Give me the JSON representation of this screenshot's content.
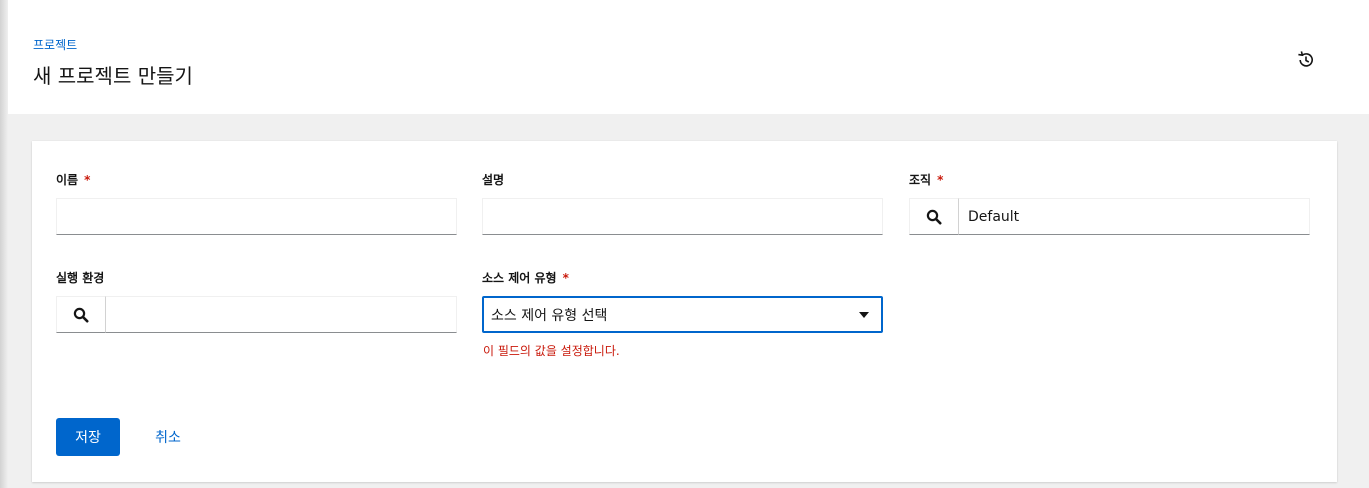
{
  "header": {
    "breadcrumb": "프로젝트",
    "title": "새 프로젝트 만들기",
    "history_icon": "history-icon"
  },
  "form": {
    "name": {
      "label": "이름",
      "required_mark": "*",
      "value": ""
    },
    "description": {
      "label": "설명",
      "value": ""
    },
    "organization": {
      "label": "조직",
      "required_mark": "*",
      "value": "Default",
      "icon": "search-icon"
    },
    "execution_env": {
      "label": "실행 환경",
      "value": "",
      "icon": "search-icon"
    },
    "scm_type": {
      "label": "소스 제어 유형",
      "required_mark": "*",
      "selected": "소스 제어 유형 선택",
      "error": "이 필드의 값을 설정합니다."
    }
  },
  "actions": {
    "save": "저장",
    "cancel": "취소"
  },
  "colors": {
    "primary": "#0066cc",
    "error": "#c9190b"
  }
}
